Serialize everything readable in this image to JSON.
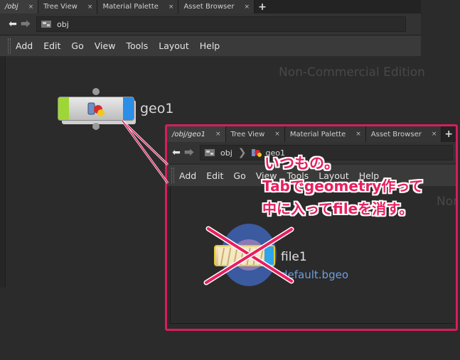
{
  "tabs": [
    {
      "label": "/obj",
      "active": true
    },
    {
      "label": "Tree View",
      "active": false
    },
    {
      "label": "Material Palette",
      "active": false
    },
    {
      "label": "Asset Browser",
      "active": false
    }
  ],
  "tab_close": "×",
  "tab_add": "+",
  "path": {
    "current": "obj"
  },
  "menu": [
    "Add",
    "Edit",
    "Go",
    "View",
    "Tools",
    "Layout",
    "Help"
  ],
  "watermark": "Non-Commercial Edition",
  "node_geo": {
    "name": "geo1"
  },
  "callout": {
    "tabs": [
      {
        "label": "/obj/geo1",
        "active": true
      },
      {
        "label": "Tree View",
        "active": false
      },
      {
        "label": "Material Palette",
        "active": false
      },
      {
        "label": "Asset Browser",
        "active": false
      }
    ],
    "path": [
      "obj",
      "geo1"
    ],
    "menu": [
      "Add",
      "Edit",
      "Go",
      "View",
      "Tools",
      "Layout",
      "Help"
    ],
    "watermark": "Non-",
    "node_file": {
      "name": "file1",
      "subtitle": "default.bgeo"
    },
    "annotation": [
      "いつもの。",
      "Tabでgeometry作って",
      "中に入ってfileを消す。"
    ]
  },
  "colors": {
    "annotation": "#e81f5f",
    "callout_border": "#d61d5d",
    "geo_left_flag": "#9ed638",
    "geo_right_flag": "#2b8ee8",
    "file_subtitle": "#6f9ee0"
  }
}
